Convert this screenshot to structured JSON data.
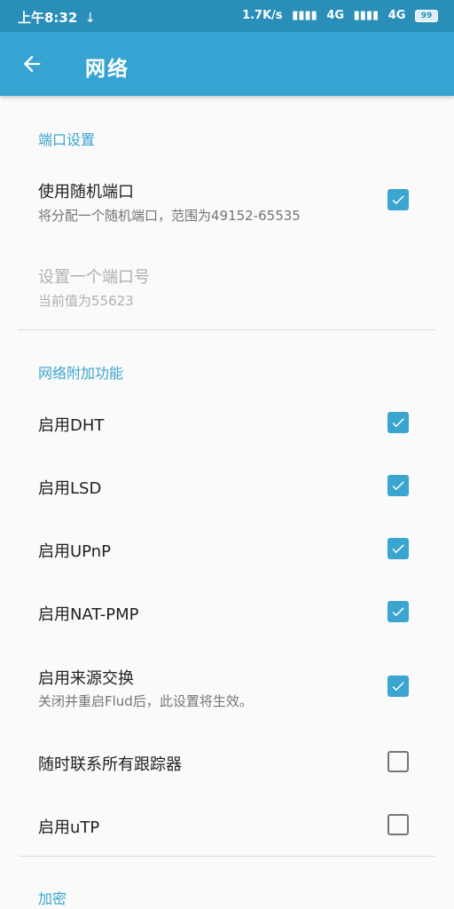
{
  "status_bar": {
    "time": "上午8:32",
    "download_icon": "↓",
    "speed": "1.7K/s",
    "net1": "4G",
    "net2": "4G",
    "battery": "99"
  },
  "app_bar": {
    "title": "网络"
  },
  "sections": {
    "port": {
      "header": "端口设置"
    },
    "net_extra": {
      "header": "网络附加功能"
    },
    "encryption": {
      "header": "加密"
    }
  },
  "prefs": {
    "random_port": {
      "title": "使用随机端口",
      "summary": "将分配一个随机端口，范围为49152-65535",
      "checked": true
    },
    "set_port": {
      "title": "设置一个端口号",
      "summary": "当前值为55623"
    },
    "dht": {
      "title": "启用DHT",
      "checked": true
    },
    "lsd": {
      "title": "启用LSD",
      "checked": true
    },
    "upnp": {
      "title": "启用UPnP",
      "checked": true
    },
    "natpmp": {
      "title": "启用NAT-PMP",
      "checked": true
    },
    "pex": {
      "title": "启用来源交换",
      "summary": "关闭并重启Flud后，此设置将生效。",
      "checked": true
    },
    "all_trackers": {
      "title": "随时联系所有跟踪器",
      "checked": false
    },
    "utp": {
      "title": "启用uTP",
      "checked": false
    }
  },
  "colors": {
    "accent": "#3aa5cf",
    "app_bar": "#36a4d3",
    "status_bar": "#2a8fb8"
  }
}
